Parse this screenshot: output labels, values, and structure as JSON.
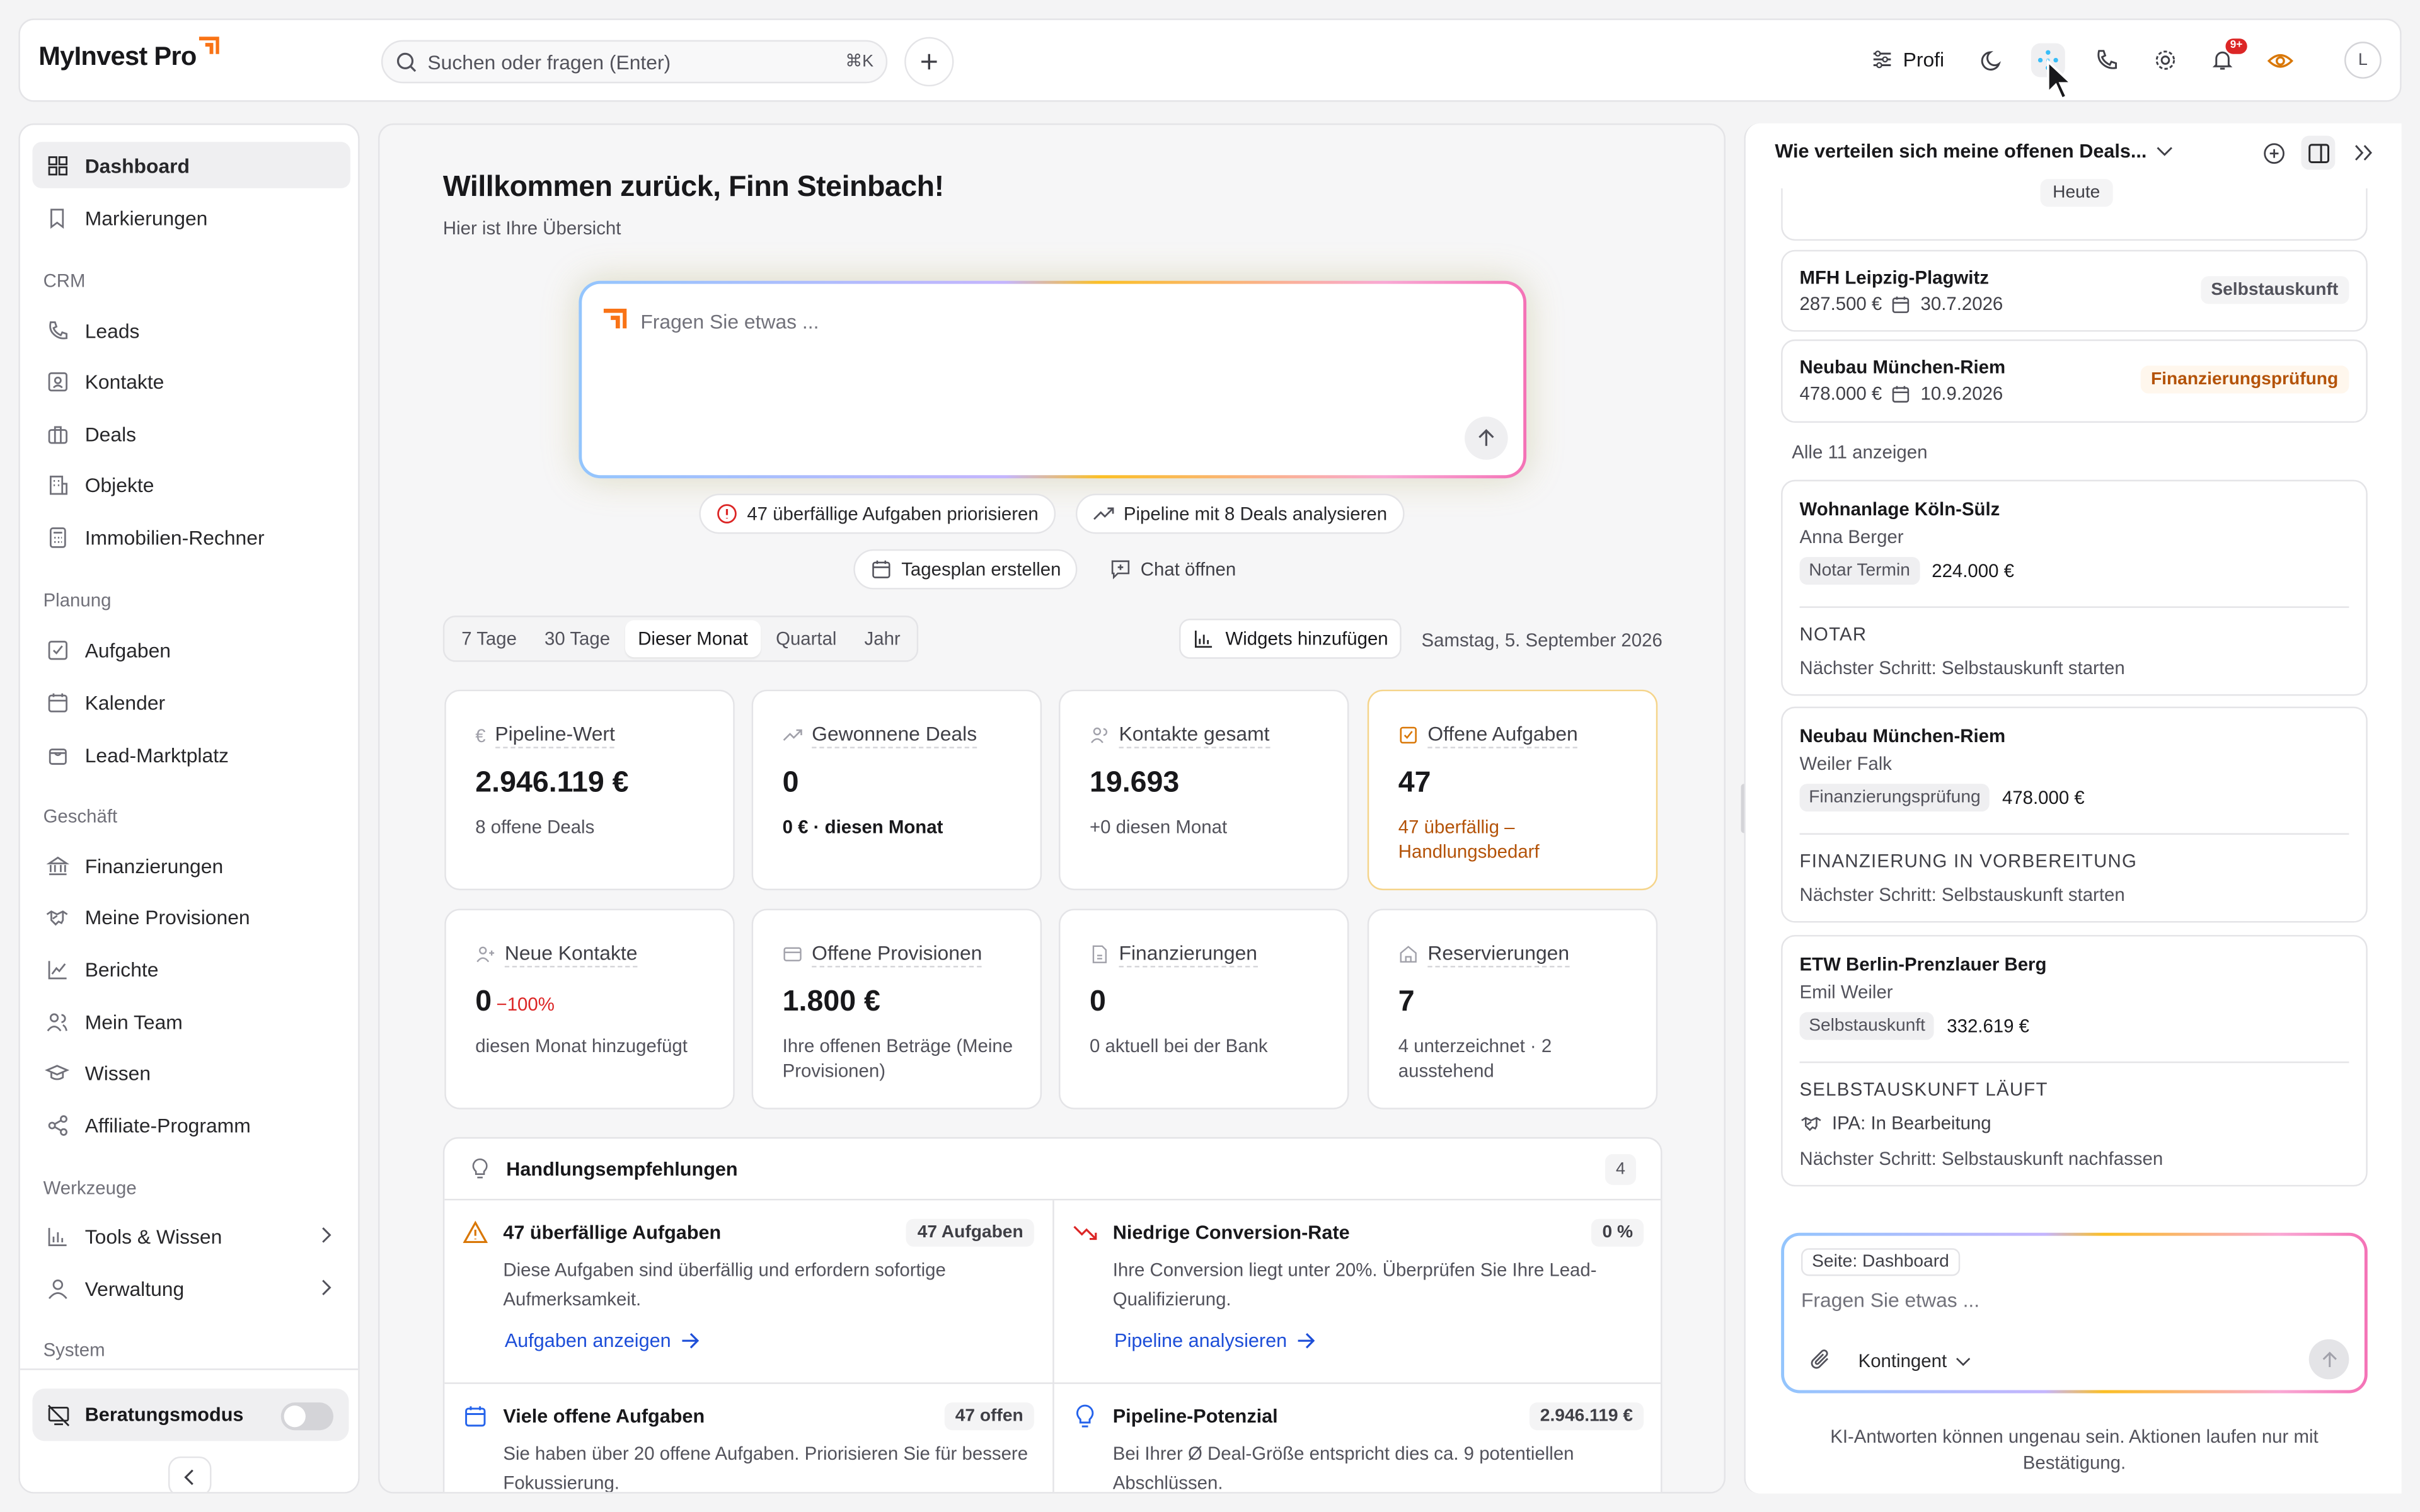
{
  "app": {
    "logo": "MyInvest Pro"
  },
  "topbar": {
    "search_placeholder": "Suchen oder fragen (Enter)",
    "search_shortcut": "⌘K",
    "profile_mode": "Profi",
    "notification_badge": "9+",
    "avatar_initial": "L"
  },
  "sidebar": {
    "items_top": [
      {
        "label": "Dashboard",
        "icon": "dashboard-icon"
      },
      {
        "label": "Markierungen",
        "icon": "bookmark-icon"
      }
    ],
    "sections": [
      {
        "title": "CRM",
        "items": [
          "Leads",
          "Kontakte",
          "Deals",
          "Objekte",
          "Immobilien-Rechner"
        ]
      },
      {
        "title": "Planung",
        "items": [
          "Aufgaben",
          "Kalender",
          "Lead-Marktplatz"
        ]
      },
      {
        "title": "Geschäft",
        "items": [
          "Finanzierungen",
          "Meine Provisionen",
          "Berichte",
          "Mein Team",
          "Wissen",
          "Affiliate-Programm"
        ]
      },
      {
        "title": "Werkzeuge",
        "items": [
          "Tools & Wissen",
          "Verwaltung"
        ]
      },
      {
        "title": "System",
        "items": []
      }
    ],
    "advisor_mode_label": "Beratungsmodus"
  },
  "main": {
    "welcome": "Willkommen zurück, Finn Steinbach!",
    "subtitle": "Hier ist Ihre Übersicht",
    "ask_placeholder": "Fragen Sie etwas ...",
    "chips": [
      "47 überfällige Aufgaben priorisieren",
      "Pipeline mit 8 Deals analysieren",
      "Tagesplan erstellen",
      "Chat öffnen"
    ],
    "periods": [
      "7 Tage",
      "30 Tage",
      "Dieser Monat",
      "Quartal",
      "Jahr"
    ],
    "selected_period": "Dieser Monat",
    "widgets_button": "Widgets hinzufügen",
    "date": "Samstag, 5. September 2026",
    "kpis": [
      {
        "label": "Pipeline-Wert",
        "value": "2.946.119 €",
        "note": "8 offene Deals"
      },
      {
        "label": "Gewonnene Deals",
        "value": "0",
        "note": "0 € · diesen Monat"
      },
      {
        "label": "Kontakte gesamt",
        "value": "19.693",
        "note": "+0 diesen Monat"
      },
      {
        "label": "Offene Aufgaben",
        "value": "47",
        "note": "47 überfällig – Handlungsbedarf"
      },
      {
        "label": "Neue Kontakte",
        "value": "0",
        "delta": "−100%",
        "note": "diesen Monat hinzugefügt"
      },
      {
        "label": "Offene Provisionen",
        "value": "1.800 €",
        "note": "Ihre offenen Beträge (Meine Provisionen)"
      },
      {
        "label": "Finanzierungen",
        "value": "0",
        "note": "0 aktuell bei der Bank"
      },
      {
        "label": "Reservierungen",
        "value": "7",
        "note": "4 unterzeichnet · 2 ausstehend"
      }
    ],
    "recommendations": {
      "title": "Handlungsempfehlungen",
      "count": "4",
      "items": [
        {
          "title": "47 überfällige Aufgaben",
          "badge": "47 Aufgaben",
          "desc": "Diese Aufgaben sind überfällig und erfordern sofortige Aufmerksamkeit.",
          "link": "Aufgaben anzeigen"
        },
        {
          "title": "Niedrige Conversion-Rate",
          "badge": "0 %",
          "desc": "Ihre Conversion liegt unter 20%. Überprüfen Sie Ihre Lead-Qualifizierung.",
          "link": "Pipeline analysieren"
        },
        {
          "title": "Viele offene Aufgaben",
          "badge": "47 offen",
          "desc": "Sie haben über 20 offene Aufgaben. Priorisieren Sie für bessere Fokussierung."
        },
        {
          "title": "Pipeline-Potenzial",
          "badge": "2.946.119 €",
          "desc": "Bei Ihrer Ø Deal-Größe entspricht dies ca. 9 potentiellen Abschlüssen."
        }
      ]
    }
  },
  "chat": {
    "question": "Wie verteilen sich meine offenen Deals...",
    "day_label": "Heute",
    "deals": [
      {
        "name": "MFH Leipzig-Plagwitz",
        "amount": "287.500 €",
        "date": "30.7.2026",
        "status": "Selbstauskunft"
      },
      {
        "name": "Neubau München-Riem",
        "amount": "478.000 €",
        "date": "10.9.2026",
        "status": "Finanzierungsprüfung"
      }
    ],
    "show_all": "Alle 11 anzeigen",
    "details": [
      {
        "name": "Wohnanlage Köln-Sülz",
        "person": "Anna Berger",
        "tag": "Notar Termin",
        "amount": "224.000 €",
        "stage": "NOTAR",
        "next": "Nächster Schritt: Selbstauskunft starten"
      },
      {
        "name": "Neubau München-Riem",
        "person": "Weiler Falk",
        "tag": "Finanzierungsprüfung",
        "amount": "478.000 €",
        "stage": "FINANZIERUNG IN VORBEREITUNG",
        "next": "Nächster Schritt: Selbstauskunft starten"
      },
      {
        "name": "ETW Berlin-Prenzlauer Berg",
        "person": "Emil Weiler",
        "tag": "Selbstauskunft",
        "amount": "332.619 €",
        "stage": "SELBSTAUSKUNFT LÄUFT",
        "ipa": "IPA: In Bearbeitung",
        "next": "Nächster Schritt: Selbstauskunft nachfassen"
      }
    ],
    "context_chip": "Seite: Dashboard",
    "input_placeholder": "Fragen Sie etwas ...",
    "quota_label": "Kontingent",
    "disclaimer": "KI-Antworten können ungenau sein. Aktionen laufen nur mit Bestätigung."
  }
}
